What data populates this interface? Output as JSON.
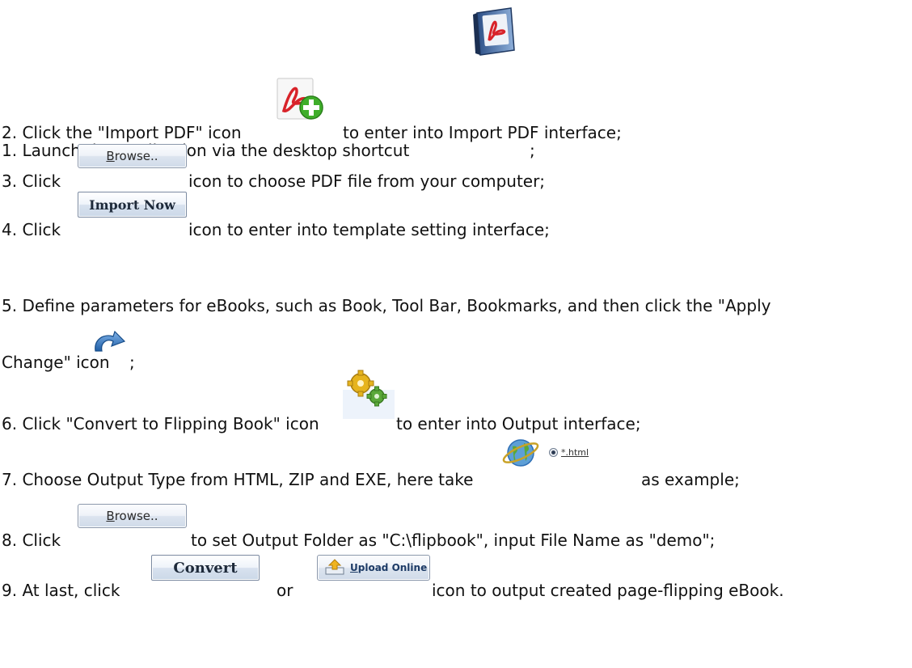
{
  "steps": [
    {
      "pre": "1. Launch the application via the desktop shortcut",
      "post": ";"
    },
    {
      "pre": "2. Click the \"Import PDF\" icon",
      "post": "to enter into Import PDF interface;"
    },
    {
      "pre": "3. Click",
      "button": "Browse..",
      "button_ul": "B",
      "button_rest": "rowse..",
      "post": "icon to choose PDF file from your computer;"
    },
    {
      "pre": "4. Click",
      "button": "Import Now",
      "post": "icon to enter into template setting interface;"
    },
    {
      "pre": "5. Define parameters for eBooks, such as Book, Tool Bar, Bookmarks, and then click the \"Apply",
      "cont": "Change\" icon",
      "post": ";"
    },
    {
      "pre": "6. Click \"Convert to Flipping Book\" icon",
      "post": "to enter into Output interface;"
    },
    {
      "pre": "7. Choose Output Type from HTML, ZIP and EXE, here take",
      "radio_label": "*.html",
      "post": "as example;"
    },
    {
      "pre": "8. Click",
      "button_ul": "B",
      "button_rest": "rowse..",
      "post": "to set Output Folder as \"C:\\flipbook\", input File Name as \"demo\";"
    },
    {
      "pre": "9. At last, click",
      "button_ul": "C",
      "button_rest": "onvert",
      "mid": "or",
      "upload_ul": "U",
      "upload_rest": "pload Online",
      "post": "icon to output created page-flipping eBook."
    }
  ],
  "icons": {
    "step1": "pdf-book-shortcut-icon",
    "step2": "import-pdf-plus-icon",
    "step5": "apply-change-refresh-icon",
    "step6": "convert-gears-icon",
    "step7": "html-globe-icon"
  },
  "colors": {
    "pdf_red": "#d8232a",
    "plus_green": "#3fae2a",
    "apply_blue": "#2f6fb5",
    "gear_yellow": "#e6b41e",
    "gear_green": "#5aa83a"
  }
}
